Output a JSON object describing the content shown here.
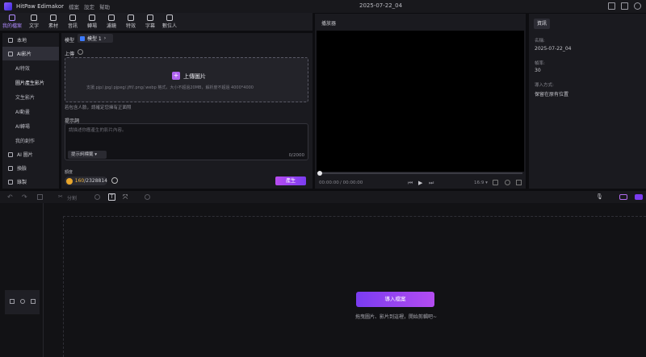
{
  "titlebar": {
    "app_name": "HitPaw Edimakor",
    "menus": [
      "檔案",
      "設定",
      "幫助"
    ],
    "project_name": "2025-07-22_04"
  },
  "toolbar": {
    "tools": [
      {
        "label": "我的檔案",
        "icon": "folder-icon",
        "active": true
      },
      {
        "label": "文字",
        "icon": "text-icon"
      },
      {
        "label": "素材",
        "icon": "assets-icon"
      },
      {
        "label": "音訊",
        "icon": "music-icon"
      },
      {
        "label": "轉場",
        "icon": "transition-icon"
      },
      {
        "label": "濾鏡",
        "icon": "filter-icon"
      },
      {
        "label": "特效",
        "icon": "effects-icon"
      },
      {
        "label": "字幕",
        "icon": "subtitle-icon"
      },
      {
        "label": "數位人",
        "icon": "avatar-icon"
      }
    ]
  },
  "leftnav": {
    "items": [
      {
        "label": "本地",
        "icon": "folder-icon",
        "selected": false
      },
      {
        "label": "AI影片",
        "icon": "ai-video-icon",
        "selected": true
      }
    ],
    "subitems": [
      "AI特效",
      "圖片產生影片",
      "文生影片",
      "AI動畫",
      "AI轉場",
      "我的創作"
    ],
    "active_sub": 1,
    "bottom_items": [
      {
        "label": "AI 圖片",
        "icon": "ai-image-icon"
      },
      {
        "label": "換臉",
        "icon": "faceswap-icon"
      },
      {
        "label": "錄製",
        "icon": "record-icon"
      }
    ]
  },
  "generator": {
    "model_label": "模型",
    "model_value": "模型 1",
    "upload_label": "上傳",
    "upload_button": "上傳圖片",
    "upload_hint": "支援.pjp/.jpg/.pjpeg/.jfif/.png/.webp 格式，大小不超過20MB，解析度不超過 4000*4000",
    "upload_note": "若包含人臉，請確定您擁有正面照",
    "prompt_label": "提示詞",
    "prompt_placeholder": "請描述你應產生的影片內容。",
    "prompt_tag": "提示詞標籤",
    "char_count": "0",
    "char_max": "/2000",
    "credits_label": "額度",
    "credits_used": "160",
    "credits_total": "/2328814",
    "generate_button": "產生"
  },
  "player": {
    "title": "播放器",
    "time_current": "00:00:00",
    "time_total": "/ 00:00:00",
    "ratio": "16:9"
  },
  "info": {
    "tab": "資訊",
    "name_label": "名稱:",
    "name_value": "2025-07-22_04",
    "fps_label": "幀率:",
    "fps_value": "30",
    "import_label": "導入方式:",
    "import_value": "保留在原有位置"
  },
  "timeline": {
    "split_label": "分割",
    "import_button": "導入檔案",
    "drop_hint": "拖曳圖片、影片到這裡，開始剪輯吧~"
  }
}
